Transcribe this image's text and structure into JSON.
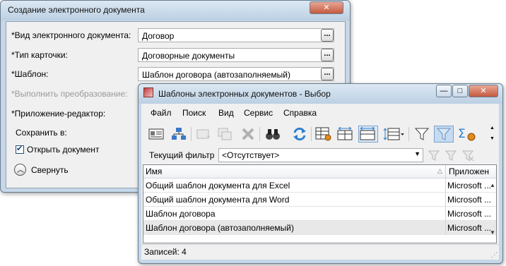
{
  "doc_window": {
    "title": "Создание электронного документа",
    "fields": [
      {
        "label": "*Вид электронного документа:",
        "value": "Договор",
        "disabled": false
      },
      {
        "label": "*Тип карточки:",
        "value": "Договорные документы",
        "disabled": false
      },
      {
        "label": "*Шаблон:",
        "value": "Шаблон договора (автозаполняемый)",
        "disabled": false
      },
      {
        "label": "*Выполнить преобразование:",
        "value": "",
        "disabled": true
      },
      {
        "label": "*Приложение-редактор:",
        "value": "",
        "disabled": false
      }
    ],
    "save_in_label": "Сохранить в:",
    "open_doc_checkbox": {
      "label": "Открыть документ",
      "checked": true
    },
    "collapse_label": "Свернуть",
    "dots_label": "..."
  },
  "templates_window": {
    "title": "Шаблоны электронных документов - Выбор",
    "menu": [
      "Файл",
      "Поиск",
      "Вид",
      "Сервис",
      "Справка"
    ],
    "filter": {
      "label": "Текущий фильтр",
      "value": "<Отсутствует>"
    },
    "columns": [
      "Имя",
      "Приложен"
    ],
    "rows": [
      {
        "name": "Общий шаблон документа для Excel",
        "app": "Microsoft ..."
      },
      {
        "name": "Общий шаблон документа для Word",
        "app": "Microsoft ..."
      },
      {
        "name": "Шаблон договора",
        "app": "Microsoft ..."
      },
      {
        "name": "Шаблон договора (автозаполняемый)",
        "app": "Microsoft ..."
      }
    ],
    "status": "Записей: 4"
  },
  "colors": {
    "title_bg": "#c6d8e8",
    "client_bg": "#f0f0f0",
    "accent": "#2b7fd3",
    "selected_row": "#e8e8e8"
  }
}
